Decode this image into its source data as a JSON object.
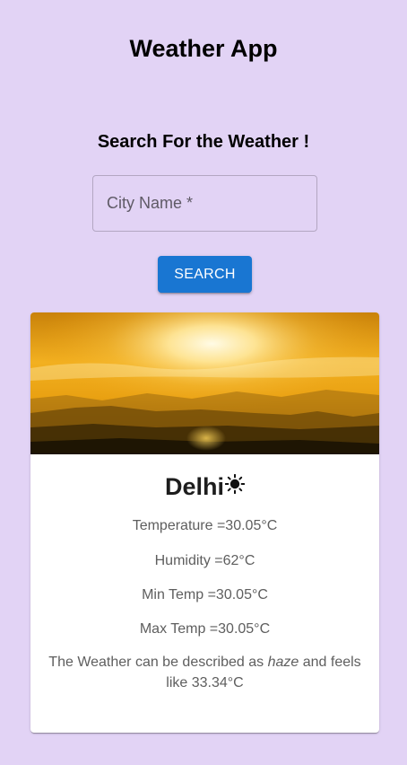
{
  "app": {
    "title": "Weather App"
  },
  "search": {
    "heading": "Search For the Weather !",
    "city_placeholder": "City Name *",
    "city_value": "",
    "button_label": "SEARCH"
  },
  "card": {
    "image_icon": "sunset-landscape-image",
    "city": "Delhi",
    "condition_icon": "sun-icon",
    "temperature_text": "Temperature =30.05°C",
    "humidity_text": "Humidity =62°C",
    "min_temp_text": "Min Temp =30.05°C",
    "max_temp_text": "Max Temp =30.05°C",
    "description_prefix": "The Weather can be described as ",
    "description_condition": "haze",
    "description_suffix": " and feels like 33.34°C"
  },
  "colors": {
    "page_background": "#e2d3f5",
    "button_primary": "#1976d2",
    "card_background": "#ffffff"
  }
}
